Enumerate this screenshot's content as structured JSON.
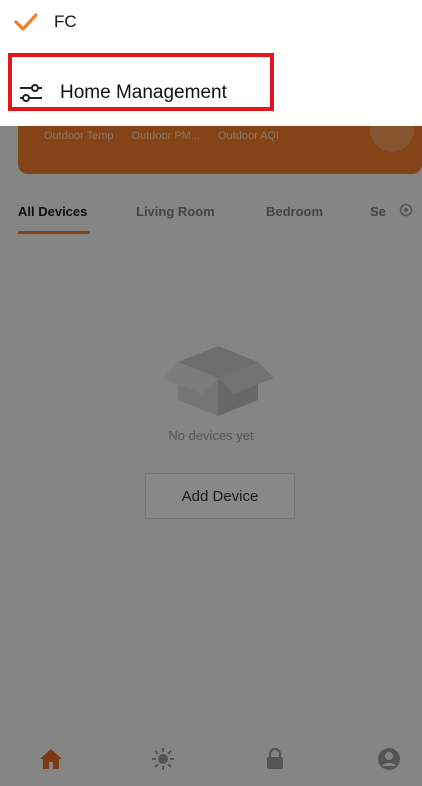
{
  "home_menu": {
    "current_home": "FC",
    "management_label": "Home Management",
    "check_icon": "checkmark-icon",
    "management_icon": "sliders-icon"
  },
  "weather": {
    "labels": [
      "Outdoor Temp",
      "Outdoor PM...",
      "Outdoor AQI"
    ]
  },
  "tabs": [
    {
      "label": "All Devices",
      "active": true
    },
    {
      "label": "Living Room",
      "active": false
    },
    {
      "label": "Bedroom",
      "active": false
    },
    {
      "label": "Se",
      "active": false
    }
  ],
  "empty_state": {
    "message": "No devices yet",
    "button_label": "Add Device"
  },
  "bottom_nav": [
    {
      "icon": "home-icon",
      "active": true
    },
    {
      "icon": "sun-icon",
      "active": false
    },
    {
      "icon": "lock-icon",
      "active": false
    },
    {
      "icon": "profile-icon",
      "active": false
    }
  ],
  "colors": {
    "accent": "#f07d2c",
    "highlight": "#e3161b"
  }
}
